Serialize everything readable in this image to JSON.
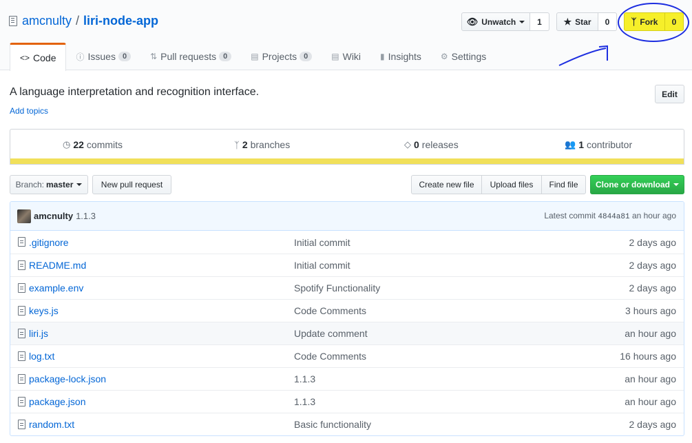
{
  "repo": {
    "owner": "amcnulty",
    "separator": "/",
    "name": "liri-node-app"
  },
  "actions": {
    "unwatch_label": "Unwatch",
    "watch_count": "1",
    "star_label": "Star",
    "star_count": "0",
    "fork_label": "Fork",
    "fork_count": "0"
  },
  "tabs": [
    {
      "label": "Code",
      "icon": "code-icon"
    },
    {
      "label": "Issues",
      "count": "0",
      "icon": "issue-icon"
    },
    {
      "label": "Pull requests",
      "count": "0",
      "icon": "pull-request-icon"
    },
    {
      "label": "Projects",
      "count": "0",
      "icon": "project-icon"
    },
    {
      "label": "Wiki",
      "icon": "book-icon"
    },
    {
      "label": "Insights",
      "icon": "graph-icon"
    },
    {
      "label": "Settings",
      "icon": "gear-icon"
    }
  ],
  "description": "A language interpretation and recognition interface.",
  "add_topics": "Add topics",
  "edit_label": "Edit",
  "summary": {
    "commits_count": "22",
    "commits_label": "commits",
    "branches_count": "2",
    "branches_label": "branches",
    "releases_count": "0",
    "releases_label": "releases",
    "contributors_count": "1",
    "contributors_label": "contributor",
    "language_color": "#f1e05a"
  },
  "file_nav": {
    "branch_label": "Branch:",
    "branch_value": "master",
    "new_pr": "New pull request",
    "create_file": "Create new file",
    "upload_files": "Upload files",
    "find_file": "Find file",
    "clone": "Clone or download"
  },
  "latest_commit": {
    "author": "amcnulty",
    "message": "1.1.3",
    "prefix": "Latest commit",
    "sha": "4844a81",
    "age": "an hour ago"
  },
  "files": [
    {
      "name": ".gitignore",
      "message": "Initial commit",
      "age": "2 days ago"
    },
    {
      "name": "README.md",
      "message": "Initial commit",
      "age": "2 days ago"
    },
    {
      "name": "example.env",
      "message": "Spotify Functionality",
      "age": "2 days ago"
    },
    {
      "name": "keys.js",
      "message": "Code Comments",
      "age": "3 hours ago"
    },
    {
      "name": "liri.js",
      "message": "Update comment",
      "age": "an hour ago"
    },
    {
      "name": "log.txt",
      "message": "Code Comments",
      "age": "16 hours ago"
    },
    {
      "name": "package-lock.json",
      "message": "1.1.3",
      "age": "an hour ago"
    },
    {
      "name": "package.json",
      "message": "1.1.3",
      "age": "an hour ago"
    },
    {
      "name": "random.txt",
      "message": "Basic functionality",
      "age": "2 days ago"
    }
  ],
  "colors": {
    "link": "#0366d6",
    "highlight": "#f6ef2a",
    "annotation": "#1d2ee0",
    "clone": "#28a745"
  }
}
